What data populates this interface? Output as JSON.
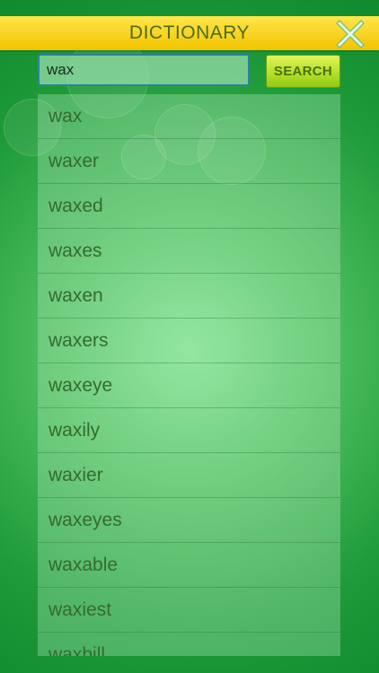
{
  "header": {
    "title": "DICTIONARY"
  },
  "search": {
    "value": "wax",
    "button_label": "SEARCH"
  },
  "results": [
    "wax",
    "waxer",
    "waxed",
    "waxes",
    "waxen",
    "waxers",
    "waxeye",
    "waxily",
    "waxier",
    "waxeyes",
    "waxable",
    "waxiest",
    "waxbill"
  ],
  "icons": {
    "close": "close-x-icon"
  },
  "colors": {
    "header_bg": "#f2c400",
    "header_text": "#4d6d1b",
    "button_bg": "#b6df2a",
    "background": "#1f9b39",
    "result_text": "#356b2f"
  }
}
